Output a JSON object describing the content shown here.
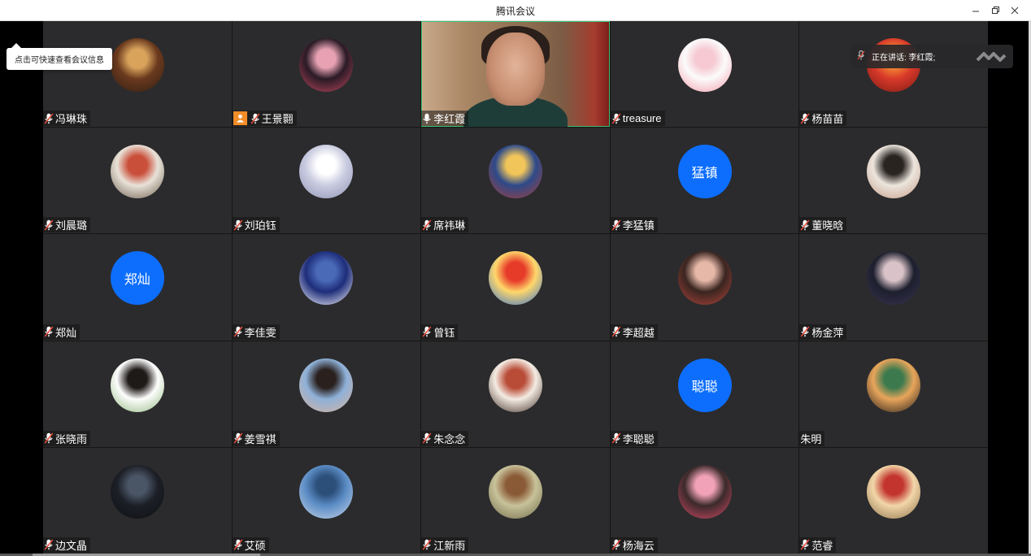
{
  "window": {
    "title": "腾讯会议",
    "minimize_glyph": "—",
    "restore_glyph": "❐",
    "close_glyph": "✕"
  },
  "tooltip": {
    "text": "点击可快速查看会议信息"
  },
  "speaking": {
    "label": "正在讲话: 李红霞;"
  },
  "colors": {
    "text_avatar_bg": "#0d6efd",
    "tile_bg": "#2b2b2d",
    "active_video_border": "#36c26e",
    "host_badge": "#f28c28"
  },
  "participants": [
    {
      "name": "冯琳珠",
      "avatar": "anime-girl-reading",
      "colors": [
        "#6b3a1e",
        "#d9a35c",
        "#2d1d14"
      ]
    },
    {
      "name": "王景翾",
      "avatar": "anime-girl-pink",
      "host": true,
      "colors": [
        "#2a1a25",
        "#e7a1b3",
        "#c14a61"
      ]
    },
    {
      "name": "李红霞",
      "avatar": "camera-video",
      "video": true,
      "mic_on": true
    },
    {
      "name": "treasure",
      "avatar": "cartoon-rabbit",
      "colors": [
        "#fbfbfb",
        "#f6c9d3",
        "#f29aa8"
      ]
    },
    {
      "name": "杨苗苗",
      "avatar": "red-cartoon",
      "colors": [
        "#d8392a",
        "#f18431",
        "#7b1b13"
      ]
    },
    {
      "name": "刘晨璐",
      "avatar": "sign-photo",
      "colors": [
        "#e9e2d8",
        "#c94f3a",
        "#6a5a4a"
      ]
    },
    {
      "name": "刘珀钰",
      "avatar": "anime-girl-white",
      "colors": [
        "#c9cbe0",
        "#ffffff",
        "#8f93b3"
      ]
    },
    {
      "name": "席祎琳",
      "avatar": "anime-girl-blonde",
      "colors": [
        "#2d4a8a",
        "#f1c55a",
        "#a83e3a"
      ]
    },
    {
      "name": "李猛镇",
      "avatar_text": "猛镇"
    },
    {
      "name": "董晓晗",
      "avatar": "girl-photo",
      "colors": [
        "#ece6de",
        "#2a2421",
        "#c49a84"
      ]
    },
    {
      "name": "郑灿",
      "avatar_text": "郑灿"
    },
    {
      "name": "李佳雯",
      "avatar": "text-banner",
      "colors": [
        "#1e2d7a",
        "#4a6ab8",
        "#ffffff"
      ]
    },
    {
      "name": "曾钰",
      "avatar": "crayon-boy",
      "colors": [
        "#ffd76a",
        "#e73b2a",
        "#2f6fd1"
      ]
    },
    {
      "name": "李超越",
      "avatar": "girl-photo-2",
      "colors": [
        "#3a2520",
        "#e6b8a8",
        "#b5463d"
      ]
    },
    {
      "name": "杨金萍",
      "avatar": "girl-photo-3",
      "colors": [
        "#1d1f2e",
        "#d9c3c8",
        "#3a3550"
      ]
    },
    {
      "name": "张晓雨",
      "avatar": "anime-girl-flowers",
      "colors": [
        "#fdfdfd",
        "#1e1a18",
        "#8fb77c"
      ]
    },
    {
      "name": "姜雪祺",
      "avatar": "girl-photo-4",
      "colors": [
        "#8fb1d8",
        "#2a211e",
        "#d9b29d"
      ]
    },
    {
      "name": "朱念念",
      "avatar": "cartoon-girl",
      "colors": [
        "#f4ece3",
        "#b94c37",
        "#3c2a22"
      ]
    },
    {
      "name": "李聪聪",
      "avatar_text": "聪聪"
    },
    {
      "name": "朱明",
      "avatar": "cartoon-boy-bun",
      "no_mic": true,
      "colors": [
        "#e8a55b",
        "#3c7a4e",
        "#1f1a17"
      ]
    },
    {
      "name": "边文晶",
      "avatar": "dark-warrior",
      "colors": [
        "#1c1f26",
        "#4a5566",
        "#0e1014"
      ]
    },
    {
      "name": "艾硕",
      "avatar": "lake-sky",
      "colors": [
        "#5b8cc5",
        "#2c4f7a",
        "#c8d6e6"
      ]
    },
    {
      "name": "江新雨",
      "avatar": "cartoon-mouse",
      "colors": [
        "#c8c29a",
        "#8a5a36",
        "#6f6a48"
      ]
    },
    {
      "name": "杨海云",
      "avatar": "pink-kirby",
      "colors": [
        "#3b2a2a",
        "#f2a2b8",
        "#d94a6a"
      ]
    },
    {
      "name": "范睿",
      "avatar": "red-string",
      "colors": [
        "#f2d7a9",
        "#c2342d",
        "#8c6f4a"
      ]
    }
  ]
}
